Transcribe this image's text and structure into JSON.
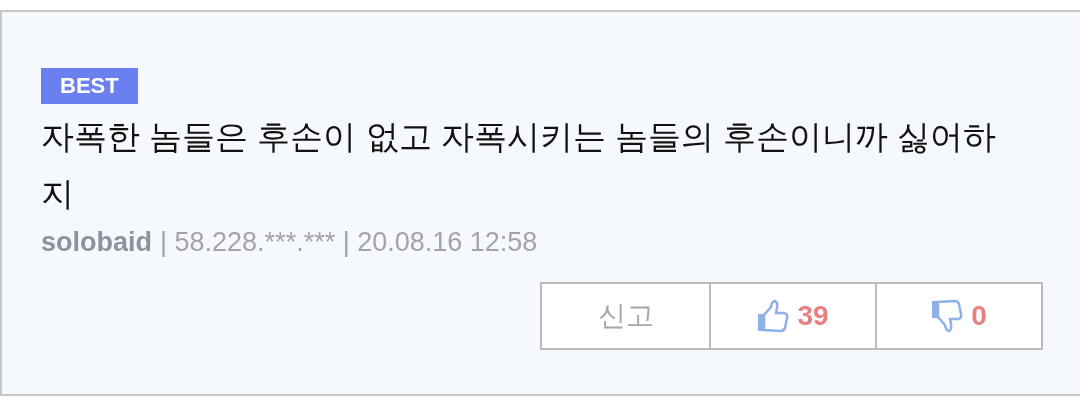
{
  "comment": {
    "badge": "BEST",
    "text": "자폭한 놈들은 후손이 없고 자폭시키는 놈들의 후손이니까 싫어하지",
    "author": "solobaid",
    "meta": "| 58.228.***.*** | 20.08.16 12:58"
  },
  "actions": {
    "report": "신고",
    "likes": "39",
    "dislikes": "0"
  }
}
